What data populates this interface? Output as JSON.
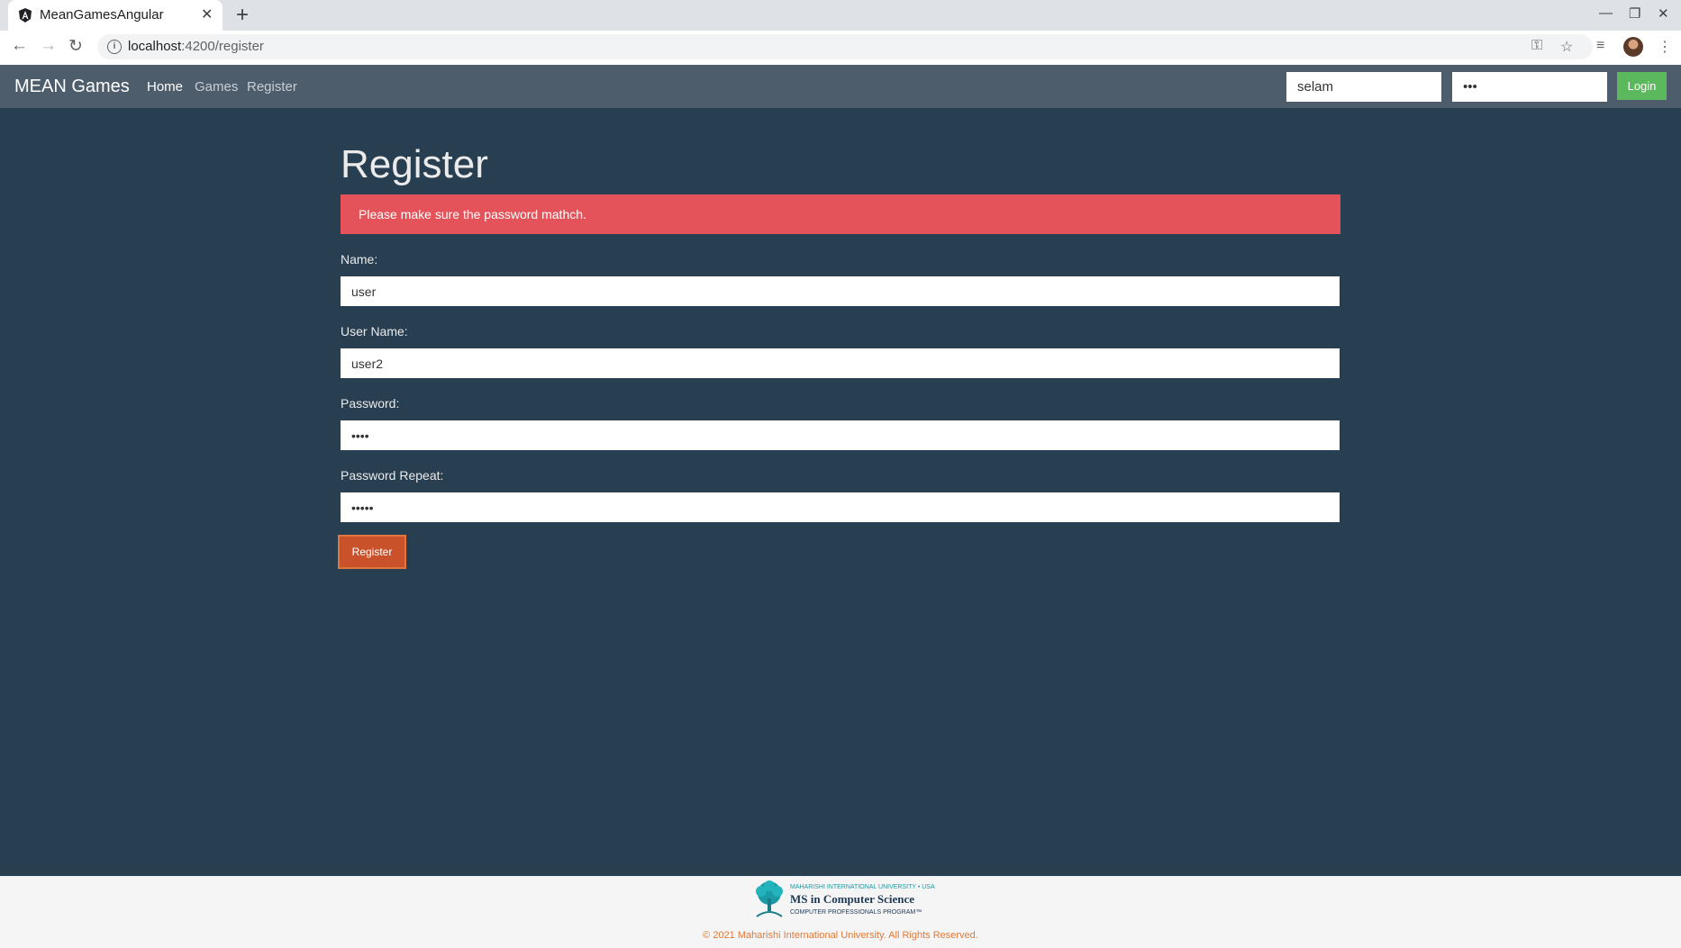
{
  "browser": {
    "tab_title": "MeanGamesAngular",
    "url_host": "localhost",
    "url_path": ":4200/register"
  },
  "navbar": {
    "brand": "MEAN Games",
    "links": [
      "Home",
      "Games",
      "Register"
    ],
    "active_link": "Home",
    "username_value": "selam",
    "password_value": "•••",
    "login_label": "Login"
  },
  "register": {
    "title": "Register",
    "alert": "Please make sure the password mathch.",
    "fields": [
      {
        "label": "Name:",
        "value": "user",
        "type": "text"
      },
      {
        "label": "User Name:",
        "value": "user2",
        "type": "text"
      },
      {
        "label": "Password:",
        "value": "••••",
        "type": "password"
      },
      {
        "label": "Password Repeat:",
        "value": "•••••",
        "type": "password"
      }
    ],
    "button_label": "Register"
  },
  "footer": {
    "logo_top": "MAHARISHI INTERNATIONAL UNIVERSITY • USA",
    "logo_main": "MS in Computer Science",
    "logo_sub": "COMPUTER PROFESSIONALS PROGRAM™",
    "copyright": "© 2021 Maharishi International University. All Rights Reserved."
  },
  "colors": {
    "page_bg": "#283e51",
    "navbar_bg": "#4e5d6c",
    "alert_bg": "#e5535a",
    "login_btn": "#5cb85c",
    "register_btn": "#c9522b"
  }
}
